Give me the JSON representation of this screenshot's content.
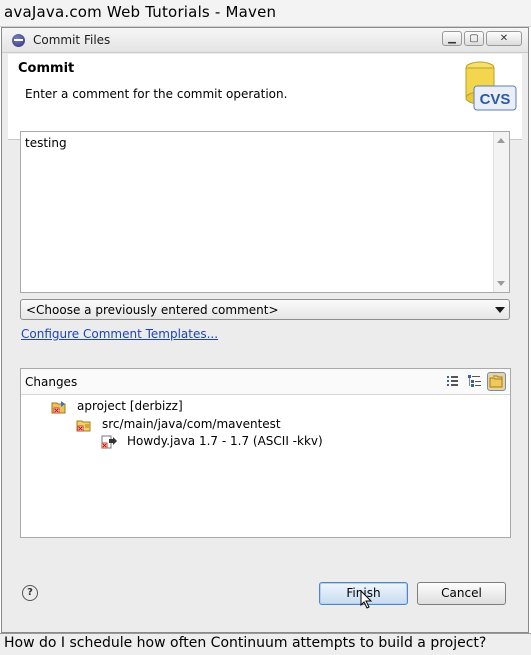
{
  "page": {
    "top_title": "avaJava.com Web Tutorials - Maven",
    "bottom_caption": "How do I schedule how often Continuum attempts to build a project?"
  },
  "dialog": {
    "title": "Commit Files",
    "header": {
      "title": "Commit",
      "description": "Enter a comment for the commit operation.",
      "icon": "cvs-icon"
    },
    "comment": {
      "value": "testing"
    },
    "previous_comment": {
      "selected": "<Choose a previously entered comment>"
    },
    "configure_link": "Configure Comment Templates...",
    "changes": {
      "label": "Changes",
      "toolbar": [
        "flat-list-icon",
        "tree-icon",
        "compressed-folders-icon"
      ],
      "tree": [
        {
          "label": "aproject   [derbizz]",
          "icon": "project-icon"
        },
        {
          "label": "src/main/java/com/maventest",
          "icon": "package-folder-icon"
        },
        {
          "label": "Howdy.java  1.7 - 1.7  (ASCII -kkv)",
          "icon": "java-file-outgoing-icon"
        }
      ]
    },
    "buttons": {
      "finish": "Finish",
      "cancel": "Cancel"
    }
  },
  "colors": {
    "link": "#1f44b5",
    "default_button": "#c8dcf2"
  }
}
